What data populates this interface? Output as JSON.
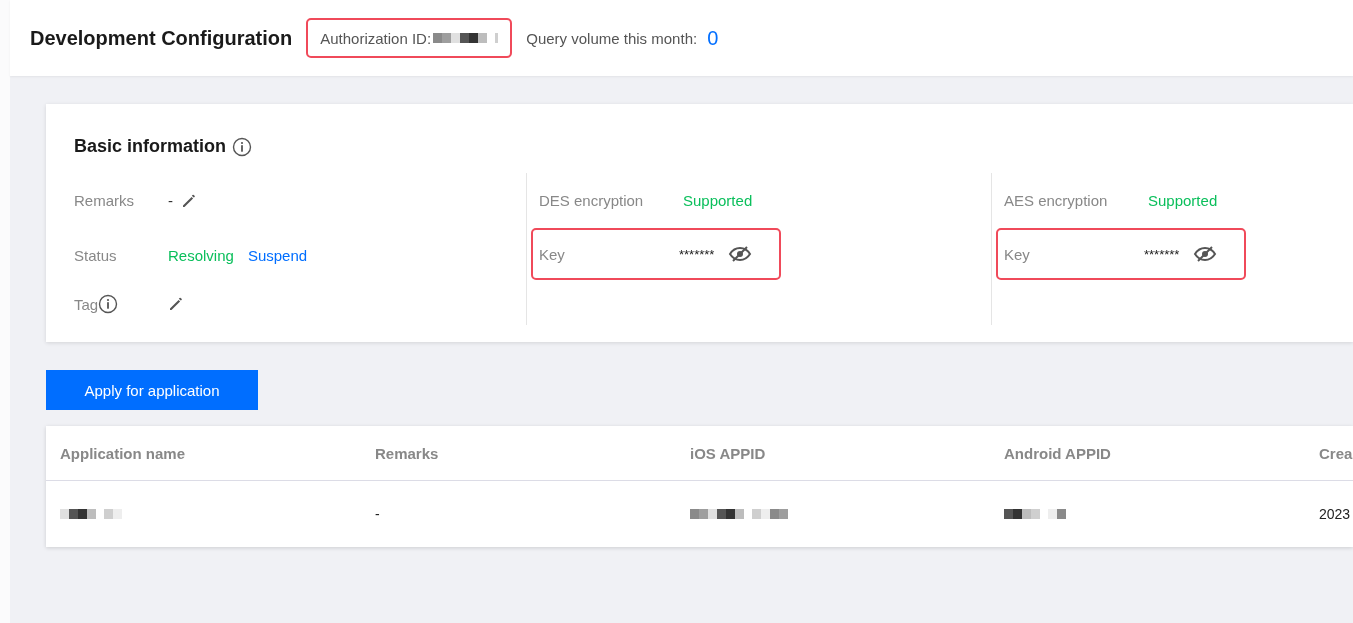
{
  "header": {
    "title": "Development Configuration",
    "authorization": {
      "label": "Authorization ID:",
      "highlighted": true
    },
    "query": {
      "label": "Query volume this month:",
      "value": "0"
    }
  },
  "basic_info": {
    "title": "Basic information",
    "columns": [
      [
        {
          "kind": "edit",
          "label": "Remarks",
          "value": "-"
        },
        {
          "kind": "status",
          "label": "Status",
          "value": "Resolving",
          "action": "Suspend"
        },
        {
          "kind": "tag",
          "label": "Tag"
        }
      ],
      [
        {
          "kind": "text",
          "label": "DES encryption",
          "value": "Supported"
        },
        {
          "kind": "secret",
          "label": "Key",
          "value": "*******",
          "highlighted": true
        }
      ],
      [
        {
          "kind": "text",
          "label": "AES encryption",
          "value": "Supported"
        },
        {
          "kind": "secret",
          "label": "Key",
          "value": "*******",
          "highlighted": true
        }
      ]
    ]
  },
  "apply_button": "Apply for application",
  "table": {
    "columns": [
      "Application name",
      "Remarks",
      "iOS APPID",
      "Android APPID",
      "Crea"
    ],
    "rows": [
      [
        {
          "kind": "redacted"
        },
        {
          "kind": "text",
          "text": "-"
        },
        {
          "kind": "redacted"
        },
        {
          "kind": "redacted"
        },
        {
          "kind": "text",
          "text": "2023"
        }
      ]
    ]
  }
}
